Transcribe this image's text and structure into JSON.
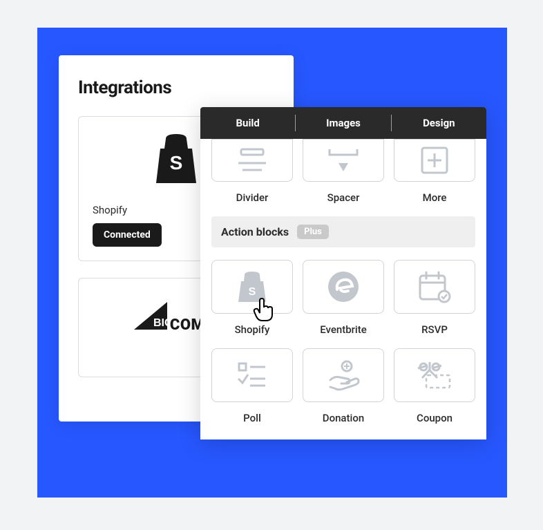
{
  "integrations": {
    "title": "Integrations",
    "cards": [
      {
        "name": "Shopify",
        "status": "Connected"
      },
      {
        "name": "BIGCOMMERCE",
        "status": null
      }
    ]
  },
  "build_panel": {
    "tabs": [
      "Build",
      "Images",
      "Design"
    ],
    "layout_blocks": [
      {
        "label": "Divider",
        "icon": "divider"
      },
      {
        "label": "Spacer",
        "icon": "spacer"
      },
      {
        "label": "More",
        "icon": "more"
      }
    ],
    "section": {
      "title": "Action blocks",
      "badge": "Plus"
    },
    "action_blocks": [
      {
        "label": "Shopify",
        "icon": "shopify"
      },
      {
        "label": "Eventbrite",
        "icon": "eventbrite"
      },
      {
        "label": "RSVP",
        "icon": "rsvp"
      },
      {
        "label": "Poll",
        "icon": "poll"
      },
      {
        "label": "Donation",
        "icon": "donation"
      },
      {
        "label": "Coupon",
        "icon": "coupon"
      }
    ]
  }
}
